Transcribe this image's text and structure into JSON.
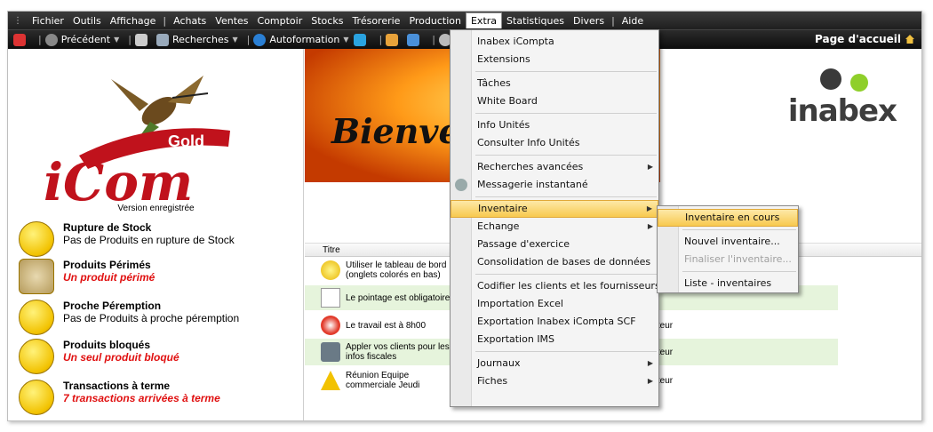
{
  "menubar": {
    "items": [
      "Fichier",
      "Outils",
      "Affichage",
      "Achats",
      "Ventes",
      "Comptoir",
      "Stocks",
      "Trésorerie",
      "Production",
      "Extra",
      "Statistiques",
      "Divers",
      "Aide"
    ],
    "active": "Extra"
  },
  "toolbar": {
    "prev": "Précédent",
    "search": "Recherches",
    "training": "Autoformation",
    "home": "Page d'accueil"
  },
  "left": {
    "logo_text": "iCom",
    "logo_badge": "Gold",
    "version": "Version enregistrée",
    "alerts": [
      {
        "title": "Rupture de Stock",
        "sub": "Pas de Produits en rupture de Stock",
        "red": false
      },
      {
        "title": "Produits Périmés",
        "sub": "Un produit périmé",
        "red": true
      },
      {
        "title": "Proche Péremption",
        "sub": "Pas de Produits à proche péremption",
        "red": false
      },
      {
        "title": "Produits bloqués",
        "sub": "Un seul produit bloqué",
        "red": true
      },
      {
        "title": "Transactions à terme",
        "sub": "7 transactions arrivées à terme",
        "red": true
      }
    ]
  },
  "center": {
    "welcome": "Bienve",
    "brand": "inabex",
    "table_header": "Titre",
    "rows": [
      {
        "title": "Utiliser le tableau de bord\n(onglets colorés en bas)",
        "who": ""
      },
      {
        "title": "Le pointage est obligatoire",
        "who": ""
      },
      {
        "title": "Le travail est à 8h00",
        "who": "istrateur"
      },
      {
        "title": "Appler vos clients pour les\ninfos fiscales",
        "who": "istrateur"
      },
      {
        "title": "Réunion Equipe\ncommerciale Jeudi",
        "who": "istrateur"
      }
    ]
  },
  "extra_menu": {
    "items": [
      "Inabex iCompta",
      "Extensions",
      "Tâches",
      "White Board",
      "Info Unités",
      "Consulter Info Unités",
      "Recherches avancées",
      "Messagerie instantané",
      "Inventaire",
      "Echange",
      "Passage d'exercice",
      "Consolidation de bases de données",
      "Codifier les clients et les fournisseurs",
      "Importation Excel",
      "Exportation Inabex iCompta SCF",
      "Exportation IMS",
      "Journaux",
      "Fiches"
    ]
  },
  "inventaire_menu": {
    "items": [
      "Inventaire en cours",
      "Nouvel inventaire...",
      "Finaliser l'inventaire...",
      "Liste - inventaires"
    ]
  }
}
